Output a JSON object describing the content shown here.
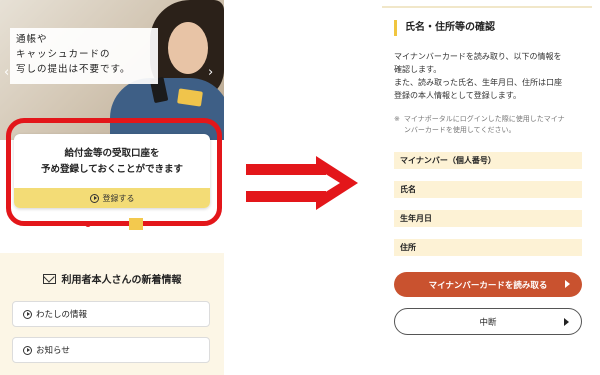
{
  "left_screen": {
    "hero": {
      "caption_lines": [
        "通帳や",
        "キャッシュカードの",
        "写しの提出は不要です。"
      ],
      "prev_icon": "chevron-left-icon",
      "next_icon": "chevron-right-icon"
    },
    "cta": {
      "title_line1": "給付金等の受取口座を",
      "title_line2": "予め登録しておくことができます",
      "button_label": "登録する",
      "button_icon": "play-circle-icon",
      "highlight_color": "#e3161a",
      "button_color": "#f3dc76"
    },
    "news": {
      "title": "利用者本人さんの新着情報",
      "title_icon": "mail-icon",
      "items": [
        {
          "label": "わたしの情報",
          "icon": "play-circle-icon"
        },
        {
          "label": "お知らせ",
          "icon": "play-circle-icon"
        }
      ]
    }
  },
  "arrow": {
    "icon": "right-arrow-icon",
    "color": "#e3161a"
  },
  "right_screen": {
    "title": "氏名・住所等の確認",
    "description_lines": [
      "マイナンバーカードを読み取り、以下の情報を",
      "確認します。",
      "また、読み取った氏名、生年月日、住所は口座",
      "登録の本人情報として登録します。"
    ],
    "note_mark": "※",
    "note_lines": [
      "マイナポータルにログインした際に使用したマイナ",
      "ンバーカードを使用してください。"
    ],
    "fields": [
      {
        "label": "マイナンバー（個人番号）"
      },
      {
        "label": "氏名"
      },
      {
        "label": "生年月日"
      },
      {
        "label": "住所"
      }
    ],
    "primary_button": "マイナンバーカードを読み取る",
    "secondary_button": "中断",
    "accent_color": "#c9522f"
  }
}
